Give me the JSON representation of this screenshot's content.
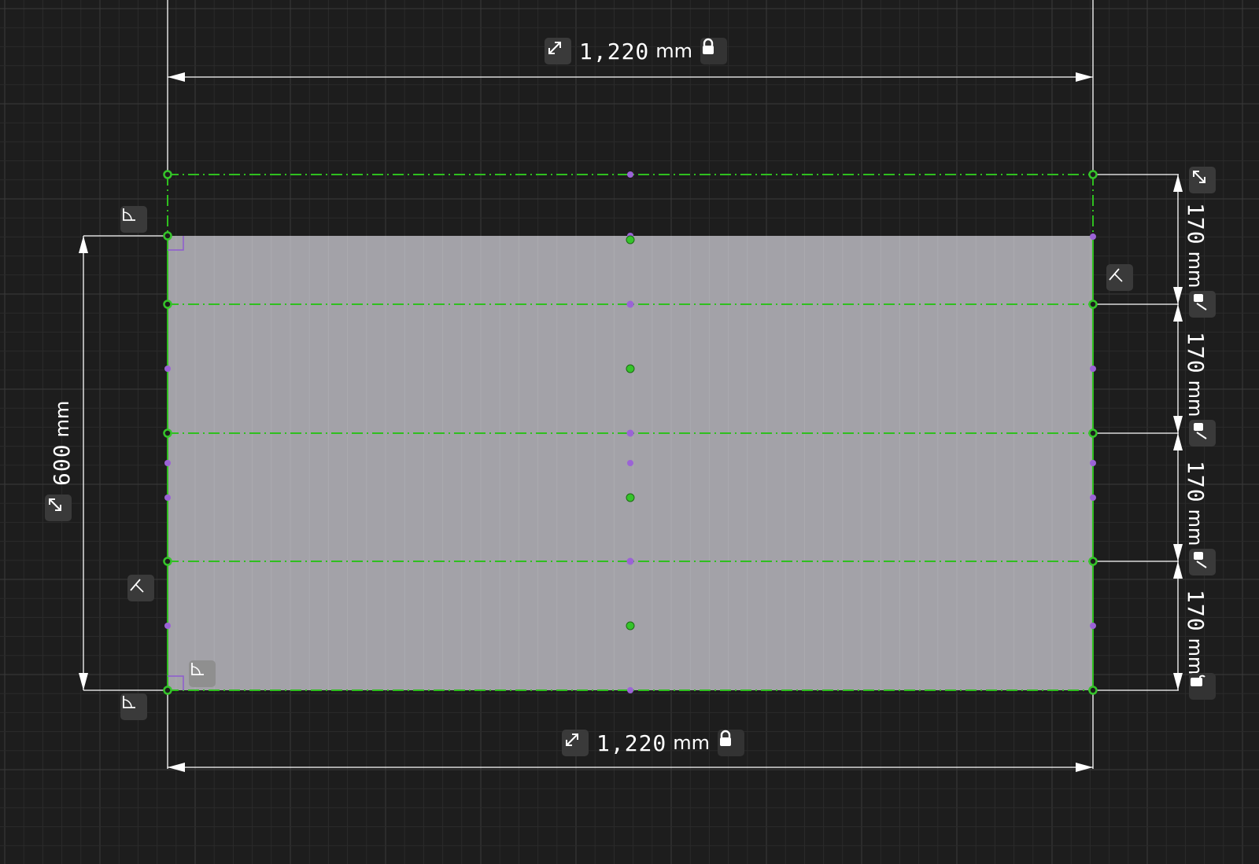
{
  "colors": {
    "background": "#1d1d1d",
    "grid_minor": "#2c2c2c",
    "grid_major": "#3d3d3d",
    "panel_fill": "#a3a2a8",
    "construction_green": "#2fbf1f",
    "point_green": "#35c42a",
    "point_purple": "#9b63d6",
    "dimension_white": "#ffffff",
    "constraint_purple": "#8e5ad0"
  },
  "dimensions": {
    "width_top": {
      "value": "1,220",
      "unit": "mm",
      "icon": "resize-diagonal-icon",
      "lock_icon": "lock-icon"
    },
    "width_bottom": {
      "value": "1,220",
      "unit": "mm",
      "icon": "resize-diagonal-icon",
      "lock_icon": "lock-icon"
    },
    "height_left": {
      "value": "600",
      "unit": "mm",
      "icon": "resize-diagonal-icon"
    },
    "spacing": [
      {
        "value": "170",
        "unit": "mm"
      },
      {
        "value": "170",
        "unit": "mm"
      },
      {
        "value": "170",
        "unit": "mm"
      },
      {
        "value": "170",
        "unit": "mm"
      }
    ]
  },
  "tools": {
    "perpendicular_icon": "perpendicular-angle-icon",
    "line_icon": "diagonal-line-icon"
  }
}
